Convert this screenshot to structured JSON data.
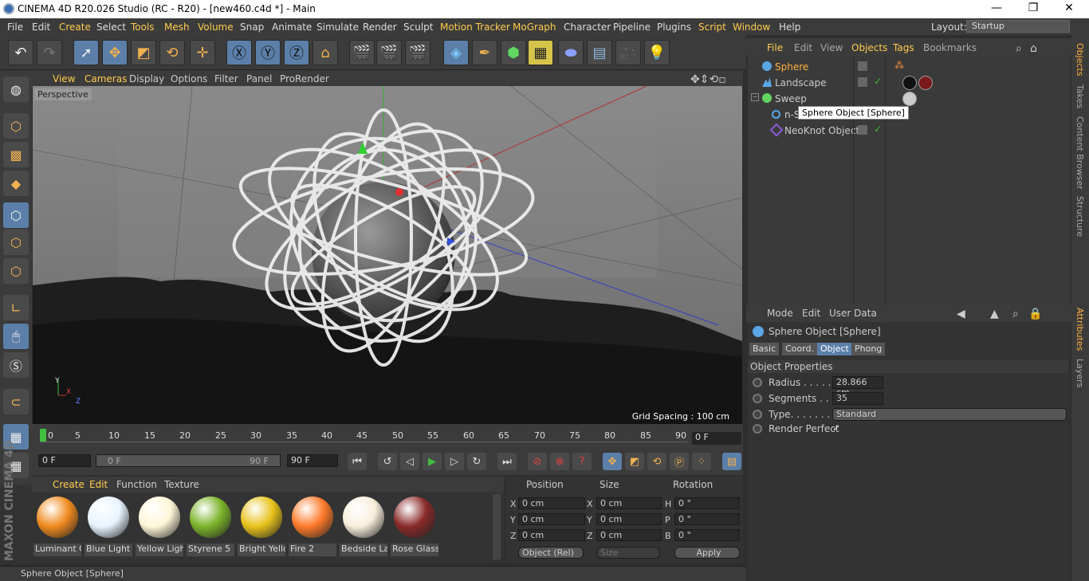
{
  "window": {
    "title": "CINEMA 4D R20.026 Studio (RC - R20) - [new460.c4d *] - Main",
    "min": "—",
    "max": "❐",
    "close": "✕"
  },
  "menubar": {
    "items": [
      "File",
      "Edit",
      "Create",
      "Select",
      "Tools",
      "Mesh",
      "Volume",
      "Snap",
      "Animate",
      "Simulate",
      "Render",
      "Sculpt",
      "Motion Tracker",
      "MoGraph",
      "Character",
      "Pipeline",
      "Plugins",
      "Script",
      "Window",
      "Help"
    ],
    "layout_label": "Layout:",
    "layout_value": "Startup"
  },
  "viewport": {
    "menu": [
      "View",
      "Cameras",
      "Display",
      "Options",
      "Filter",
      "Panel",
      "ProRender"
    ],
    "camera": "Perspective",
    "grid_spacing": "Grid Spacing : 100 cm"
  },
  "timeline": {
    "ticks": [
      "0",
      "5",
      "10",
      "15",
      "20",
      "25",
      "30",
      "35",
      "40",
      "45",
      "50",
      "55",
      "60",
      "65",
      "70",
      "75",
      "80",
      "85",
      "90"
    ],
    "current_frame": "0 F",
    "start": "0 F",
    "range_start": "0 F",
    "range_end": "90 F",
    "end": "90 F"
  },
  "materials": {
    "menu": [
      "Create",
      "Edit",
      "Function",
      "Texture"
    ],
    "items": [
      {
        "name": "Luminant C",
        "color": "#f08a1e"
      },
      {
        "name": "Blue Light",
        "color": "#e8f4ff"
      },
      {
        "name": "Yellow Ligh",
        "color": "#fff6d8"
      },
      {
        "name": "Styrene 5",
        "color": "#7bb32a"
      },
      {
        "name": "Bright Yello",
        "color": "#e8c21a"
      },
      {
        "name": "Fire 2",
        "color": "#ff7a2a"
      },
      {
        "name": "Bedside La",
        "color": "#f8eedc"
      },
      {
        "name": "Rose Glass",
        "color": "#8a2a2a"
      }
    ]
  },
  "coords": {
    "headers": {
      "position": "Position",
      "size": "Size",
      "rotation": "Rotation"
    },
    "rows": [
      {
        "pl": "X",
        "pv": "0 cm",
        "sl": "X",
        "sv": "0 cm",
        "rl": "H",
        "rv": "0 °"
      },
      {
        "pl": "Y",
        "pv": "0 cm",
        "sl": "Y",
        "sv": "0 cm",
        "rl": "P",
        "rv": "0 °"
      },
      {
        "pl": "Z",
        "pv": "0 cm",
        "sl": "Z",
        "sv": "0 cm",
        "rl": "B",
        "rv": "0 °"
      }
    ],
    "mode": "Object (Rel)",
    "size_mode": "Size",
    "apply": "Apply"
  },
  "status": "Sphere Object [Sphere]",
  "objects": {
    "menu": [
      "File",
      "Edit",
      "View",
      "Objects",
      "Tags",
      "Bookmarks"
    ],
    "rows": [
      {
        "name": "Sphere"
      },
      {
        "name": "Landscape"
      },
      {
        "name": "Sweep"
      },
      {
        "name": "n-Side"
      },
      {
        "name": "NeoKnot Object"
      }
    ],
    "tooltip": "Sphere Object [Sphere]"
  },
  "attributes": {
    "menu": [
      "Mode",
      "Edit",
      "User Data"
    ],
    "title": "Sphere Object [Sphere]",
    "tabs": [
      "Basic",
      "Coord.",
      "Object",
      "Phong"
    ],
    "section": "Object Properties",
    "props": [
      {
        "label": "Radius . . . . . . .",
        "value": "28.866 cm"
      },
      {
        "label": "Segments . . . .",
        "value": "35"
      },
      {
        "label": "Type. . . . . . . . .",
        "value": "Standard"
      },
      {
        "label": "Render Perfect",
        "value": "✓"
      }
    ]
  },
  "sidetabs": [
    "Objects",
    "Takes",
    "Content Browser",
    "Structure",
    "Attributes",
    "Layers"
  ],
  "logo": "MAXON CINEMA 4D"
}
